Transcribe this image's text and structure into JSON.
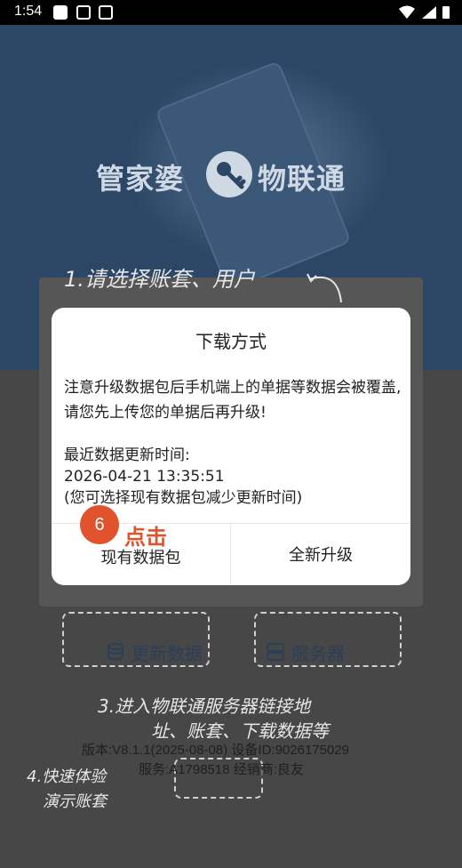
{
  "status_bar": {
    "time": "1:54"
  },
  "hero": {
    "logo_left": "管家婆",
    "logo_right": "物联通"
  },
  "hints": {
    "select_account": "1.请选择账套、用户",
    "connect_line1": "3.进入物联通服务器链接地",
    "connect_line2": "址、账套、下载数据等",
    "demo_line1": "4.快速体验",
    "demo_line2": "演示账套"
  },
  "actions": {
    "update_data": "更新数据",
    "server": "服务器"
  },
  "footer": {
    "version_line": "版本:V8.1.1(2025-08-08)   设备ID:9026175029",
    "service_line": "服务:A1798518   经销商:良友"
  },
  "dialog": {
    "title": "下载方式",
    "message": "注意升级数据包后手机端上的单据等数据会被覆盖,请您先上传您的单据后再升级!",
    "last_update_label": "最近数据更新时间:",
    "last_update_time": "2026-04-21 13:35:51",
    "hint": "(您可选择现有数据包减少更新时间)",
    "btn_existing": "现有数据包",
    "btn_full": "全新升级"
  },
  "overlay": {
    "step_number": "6",
    "step_label": "点击",
    "accent": "#e0532d"
  },
  "colors": {
    "hero_bg": "#2c4666",
    "dim_bg": "#474747"
  }
}
